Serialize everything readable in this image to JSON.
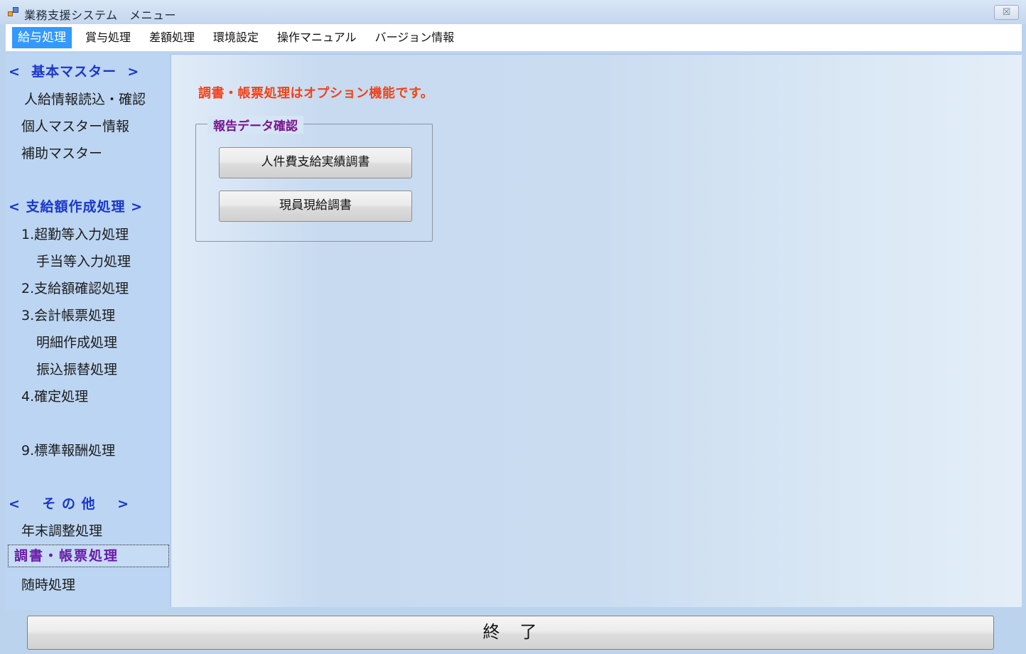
{
  "window": {
    "title": "業務支援システム　メニュー",
    "close_label": "☒"
  },
  "menu": {
    "items": [
      {
        "label": "給与処理"
      },
      {
        "label": "賞与処理"
      },
      {
        "label": "差額処理"
      },
      {
        "label": "環境設定"
      },
      {
        "label": "操作マニュアル"
      },
      {
        "label": "バージョン情報"
      }
    ],
    "active": "給与処理"
  },
  "sidebar": {
    "section_master": "<  基本マスター  >",
    "master_items": [
      "人給情報読込・確認",
      "個人マスター情報",
      "補助マスター"
    ],
    "section_payment": "< 支給額作成処理 >",
    "payment_items": [
      "1.超勤等入力処理",
      "手当等入力処理",
      "2.支給額確認処理",
      "3.会計帳票処理",
      "明細作成処理",
      "振込振替処理",
      "4.確定処理",
      "9.標準報酬処理"
    ],
    "section_other": "<    そ の 他    >",
    "other_items": [
      "年末調整処理",
      "調書・帳票処理",
      "随時処理"
    ],
    "selected": "調書・帳票処理"
  },
  "main": {
    "notice": "調書・帳票処理はオプション機能です。",
    "group_title": "報告データ確認",
    "buttons": [
      "人件費支給実績調書",
      "現員現給調書"
    ]
  },
  "footer": {
    "exit_label": "終　了"
  }
}
